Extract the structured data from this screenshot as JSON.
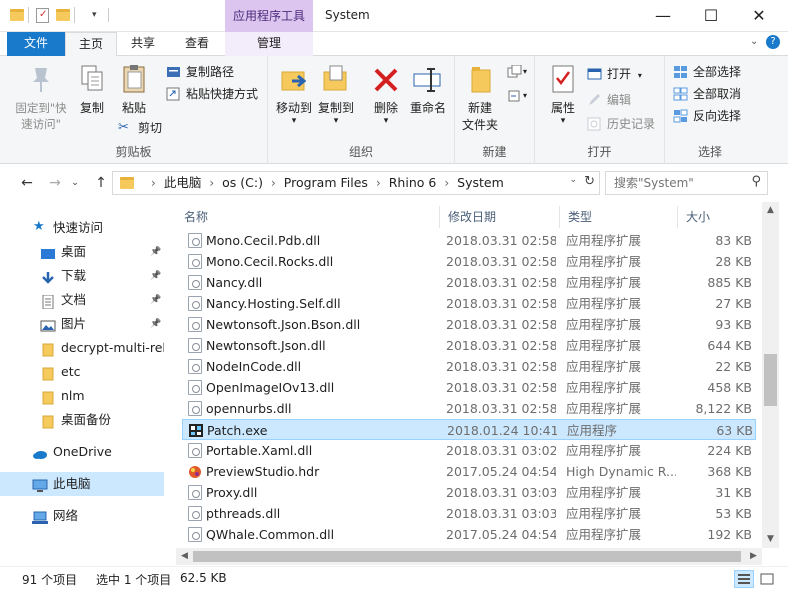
{
  "window": {
    "title": "System",
    "context_tab_title": "应用程序工具",
    "minimize": "—",
    "maximize": "☐",
    "close": "✕"
  },
  "tabs": {
    "file": "文件",
    "home": "主页",
    "share": "共享",
    "view": "查看",
    "manage": "管理"
  },
  "ribbon": {
    "clipboard": {
      "label": "剪贴板",
      "pin": "固定到\"快速访问\"",
      "copy": "复制",
      "paste": "粘贴",
      "copy_path": "复制路径",
      "paste_shortcut": "粘贴快捷方式",
      "cut": "剪切"
    },
    "organize": {
      "label": "组织",
      "move_to": "移动到",
      "copy_to": "复制到",
      "delete": "删除",
      "rename": "重命名"
    },
    "new": {
      "label": "新建",
      "new_folder": "新建\n文件夹"
    },
    "open": {
      "label": "打开",
      "properties": "属性",
      "open": "打开",
      "edit": "编辑",
      "history": "历史记录"
    },
    "select": {
      "label": "选择",
      "select_all": "全部选择",
      "select_none": "全部取消",
      "invert": "反向选择"
    }
  },
  "address": {
    "crumbs": [
      "此电脑",
      "os (C:)",
      "Program Files",
      "Rhino 6",
      "System"
    ],
    "search_placeholder": "搜索\"System\""
  },
  "nav": {
    "quick_access": "快速访问",
    "items": [
      {
        "label": "桌面",
        "icon": "desktop-icon",
        "pinned": true
      },
      {
        "label": "下载",
        "icon": "download-icon",
        "pinned": true
      },
      {
        "label": "文档",
        "icon": "document-icon",
        "pinned": true
      },
      {
        "label": "图片",
        "icon": "picture-icon",
        "pinned": true
      },
      {
        "label": "decrypt-multi-rele",
        "icon": "folder-icon",
        "pinned": false
      },
      {
        "label": "etc",
        "icon": "folder-icon",
        "pinned": false
      },
      {
        "label": "nlm",
        "icon": "folder-icon",
        "pinned": false
      },
      {
        "label": "桌面备份",
        "icon": "folder-icon",
        "pinned": false
      }
    ],
    "onedrive": "OneDrive",
    "this_pc": "此电脑",
    "network": "网络"
  },
  "columns": {
    "name": "名称",
    "date": "修改日期",
    "type": "类型",
    "size": "大小"
  },
  "files": [
    {
      "name": "Mono.Cecil.Pdb.dll",
      "date": "2018.03.31 02:58",
      "type": "应用程序扩展",
      "size": "83 KB",
      "icon": "dll"
    },
    {
      "name": "Mono.Cecil.Rocks.dll",
      "date": "2018.03.31 02:58",
      "type": "应用程序扩展",
      "size": "28 KB",
      "icon": "dll"
    },
    {
      "name": "Nancy.dll",
      "date": "2018.03.31 02:58",
      "type": "应用程序扩展",
      "size": "885 KB",
      "icon": "dll"
    },
    {
      "name": "Nancy.Hosting.Self.dll",
      "date": "2018.03.31 02:58",
      "type": "应用程序扩展",
      "size": "27 KB",
      "icon": "dll"
    },
    {
      "name": "Newtonsoft.Json.Bson.dll",
      "date": "2018.03.31 02:58",
      "type": "应用程序扩展",
      "size": "93 KB",
      "icon": "dll"
    },
    {
      "name": "Newtonsoft.Json.dll",
      "date": "2018.03.31 02:58",
      "type": "应用程序扩展",
      "size": "644 KB",
      "icon": "dll"
    },
    {
      "name": "NodeInCode.dll",
      "date": "2018.03.31 02:58",
      "type": "应用程序扩展",
      "size": "22 KB",
      "icon": "dll"
    },
    {
      "name": "OpenImageIOv13.dll",
      "date": "2018.03.31 02:58",
      "type": "应用程序扩展",
      "size": "458 KB",
      "icon": "dll"
    },
    {
      "name": "opennurbs.dll",
      "date": "2018.03.31 02:58",
      "type": "应用程序扩展",
      "size": "8,122 KB",
      "icon": "dll"
    },
    {
      "name": "Patch.exe",
      "date": "2018.01.24 10:41",
      "type": "应用程序",
      "size": "63 KB",
      "icon": "exe",
      "selected": true
    },
    {
      "name": "Portable.Xaml.dll",
      "date": "2018.03.31 03:02",
      "type": "应用程序扩展",
      "size": "224 KB",
      "icon": "dll"
    },
    {
      "name": "PreviewStudio.hdr",
      "date": "2017.05.24 04:54",
      "type": "High Dynamic R...",
      "size": "368 KB",
      "icon": "hdr"
    },
    {
      "name": "Proxy.dll",
      "date": "2018.03.31 03:03",
      "type": "应用程序扩展",
      "size": "31 KB",
      "icon": "dll"
    },
    {
      "name": "pthreads.dll",
      "date": "2018.03.31 03:03",
      "type": "应用程序扩展",
      "size": "53 KB",
      "icon": "dll"
    },
    {
      "name": "QWhale.Common.dll",
      "date": "2017.05.24 04:54",
      "type": "应用程序扩展",
      "size": "192 KB",
      "icon": "dll"
    }
  ],
  "status": {
    "count": "91 个项目",
    "selection": "选中 1 个项目",
    "size": "62.5 KB"
  },
  "colors": {
    "accent": "#1979ca",
    "selection_bg": "#cce8ff",
    "selection_border": "#99d1ff",
    "context_tab": "#dcc6f0"
  }
}
